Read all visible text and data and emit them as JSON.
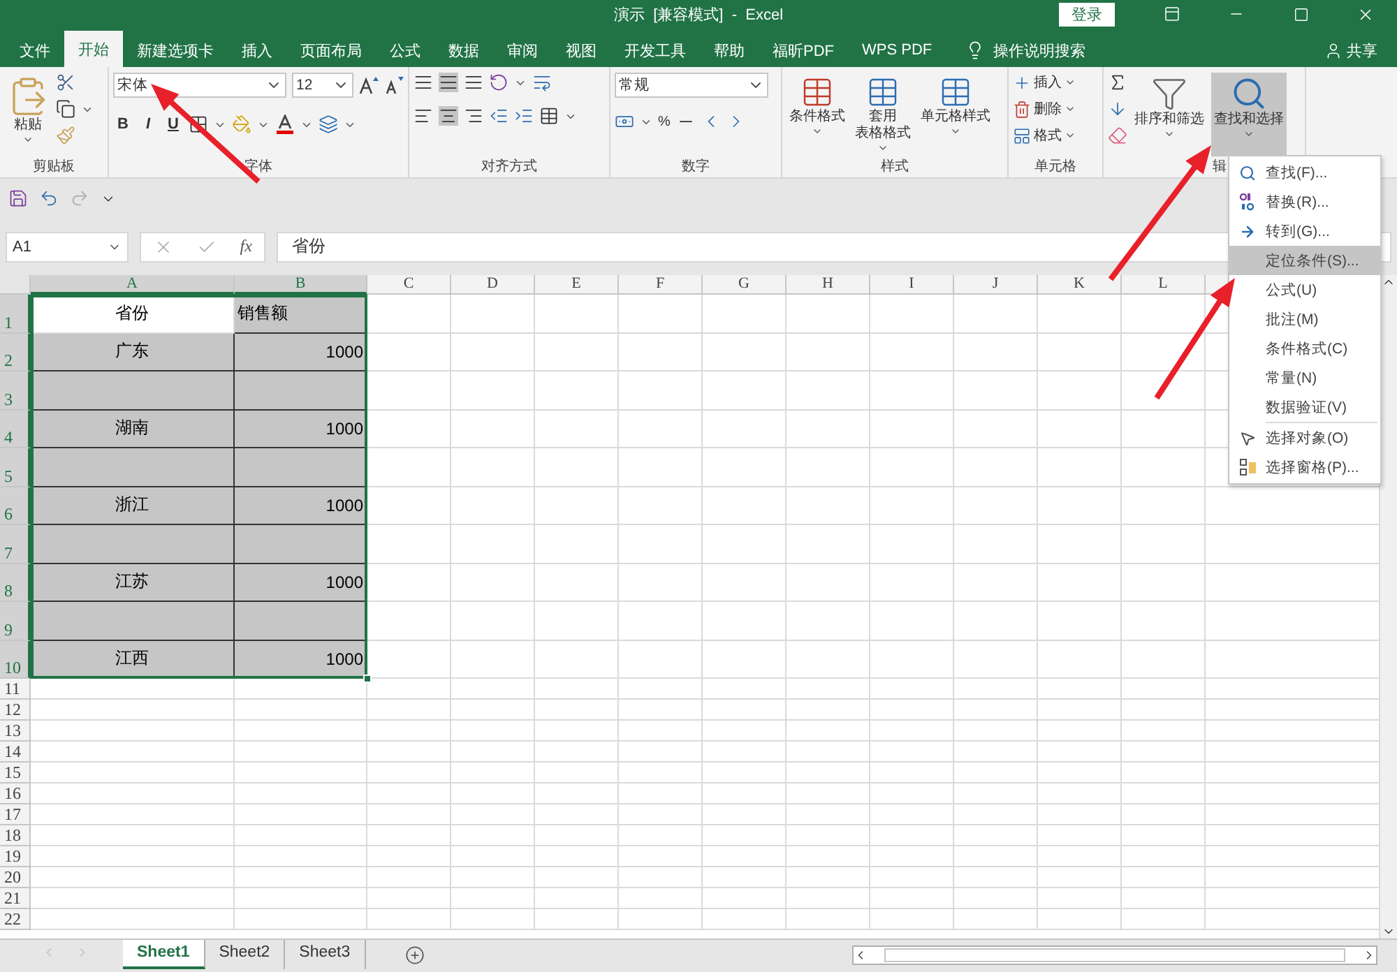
{
  "title_bar": {
    "title": "演示  [兼容模式]  -  Excel",
    "sign_in": "登录"
  },
  "tabs": [
    {
      "label": "文件",
      "selected": false
    },
    {
      "label": "开始",
      "selected": true
    },
    {
      "label": "新建选项卡",
      "selected": false
    },
    {
      "label": "插入",
      "selected": false
    },
    {
      "label": "页面布局",
      "selected": false
    },
    {
      "label": "公式",
      "selected": false
    },
    {
      "label": "数据",
      "selected": false
    },
    {
      "label": "审阅",
      "selected": false
    },
    {
      "label": "视图",
      "selected": false
    },
    {
      "label": "开发工具",
      "selected": false
    },
    {
      "label": "帮助",
      "selected": false
    },
    {
      "label": "福昕PDF",
      "selected": false
    },
    {
      "label": "WPS PDF",
      "selected": false
    }
  ],
  "tell_me": "操作说明搜索",
  "share": "共享",
  "ribbon": {
    "clipboard": {
      "label": "剪贴板",
      "paste": "粘贴"
    },
    "font": {
      "label": "字体",
      "font_name": "宋体",
      "font_size": "12",
      "bold": "B",
      "italic": "I",
      "underline": "U"
    },
    "alignment": {
      "label": "对齐方式"
    },
    "number": {
      "label": "数字",
      "format": "常规",
      "percent": "%"
    },
    "styles": {
      "label": "样式",
      "buttons": [
        {
          "lines": [
            "条件格式"
          ]
        },
        {
          "lines": [
            "套用",
            "表格格式"
          ]
        },
        {
          "lines": [
            "单元格样式"
          ]
        }
      ]
    },
    "cells": {
      "label": "单元格",
      "buttons": [
        "插入",
        "删除",
        "格式"
      ]
    },
    "editing": {
      "label": "辑",
      "sort": "排序和筛选",
      "find": "查找和选择",
      "find_selected": true
    }
  },
  "formula_bar": {
    "name_box": "A1",
    "fx": "fx",
    "value": "省份"
  },
  "columns": [
    {
      "label": "A",
      "selected": true
    },
    {
      "label": "B",
      "selected": true
    },
    {
      "label": "C",
      "selected": false
    },
    {
      "label": "D",
      "selected": false
    },
    {
      "label": "E",
      "selected": false
    },
    {
      "label": "F",
      "selected": false
    },
    {
      "label": "G",
      "selected": false
    },
    {
      "label": "H",
      "selected": false
    },
    {
      "label": "I",
      "selected": false
    },
    {
      "label": "J",
      "selected": false
    },
    {
      "label": "K",
      "selected": false
    },
    {
      "label": "L",
      "selected": false
    }
  ],
  "rows": [
    {
      "header": "1",
      "selected": true,
      "cells": [
        {
          "text": "省份",
          "selected": false
        },
        {
          "text": "销售额",
          "selected": true
        }
      ]
    },
    {
      "header": "2",
      "selected": true,
      "cells": [
        {
          "text": "广东",
          "selected": true
        },
        {
          "text": "1000",
          "selected": true
        }
      ]
    },
    {
      "header": "3",
      "selected": true,
      "cells": [
        {
          "selected": true
        },
        {
          "selected": true
        }
      ]
    },
    {
      "header": "4",
      "selected": true,
      "cells": [
        {
          "text": "湖南",
          "selected": true
        },
        {
          "text": "1000",
          "selected": true
        }
      ]
    },
    {
      "header": "5",
      "selected": true,
      "cells": [
        {
          "selected": true
        },
        {
          "selected": true
        }
      ]
    },
    {
      "header": "6",
      "selected": true,
      "cells": [
        {
          "text": "浙江",
          "selected": true
        },
        {
          "text": "1000",
          "selected": true
        }
      ]
    },
    {
      "header": "7",
      "selected": true,
      "cells": [
        {
          "selected": true
        },
        {
          "selected": true
        }
      ]
    },
    {
      "header": "8",
      "selected": true,
      "cells": [
        {
          "text": "江苏",
          "selected": true
        },
        {
          "text": "1000",
          "selected": true
        }
      ]
    },
    {
      "header": "9",
      "selected": true,
      "cells": [
        {
          "selected": true
        },
        {
          "selected": true
        }
      ]
    },
    {
      "header": "10",
      "selected": true,
      "cells": [
        {
          "text": "江西",
          "selected": true
        },
        {
          "text": "1000",
          "selected": true
        }
      ]
    },
    {
      "header": "11",
      "selected": false
    },
    {
      "header": "12",
      "selected": false
    },
    {
      "header": "13",
      "selected": false
    },
    {
      "header": "14",
      "selected": false
    },
    {
      "header": "15",
      "selected": false
    },
    {
      "header": "16",
      "selected": false
    },
    {
      "header": "17",
      "selected": false
    },
    {
      "header": "18",
      "selected": false
    },
    {
      "header": "19",
      "selected": false
    },
    {
      "header": "20",
      "selected": false
    },
    {
      "header": "21",
      "selected": false
    },
    {
      "header": "22",
      "selected": false
    }
  ],
  "sheets": [
    {
      "label": "Sheet1",
      "selected": true
    },
    {
      "label": "Sheet2",
      "selected": false
    },
    {
      "label": "Sheet3",
      "selected": false
    }
  ],
  "menu": {
    "groups": [
      [
        {
          "kind": "find",
          "label": "查找(F)...",
          "selected": false
        },
        {
          "kind": "replace",
          "label": "替换(R)...",
          "selected": false
        },
        {
          "kind": "goto",
          "label": "转到(G)...",
          "selected": false
        },
        {
          "kind": "plain",
          "label": "定位条件(S)...",
          "selected": true
        },
        {
          "kind": "plain",
          "label": "公式(U)",
          "selected": false
        },
        {
          "kind": "plain",
          "label": "批注(M)",
          "selected": false
        },
        {
          "kind": "plain",
          "label": "条件格式(C)",
          "selected": false
        },
        {
          "kind": "plain",
          "label": "常量(N)",
          "selected": false
        },
        {
          "kind": "plain",
          "label": "数据验证(V)",
          "selected": false
        }
      ],
      [
        {
          "kind": "pointer",
          "label": "选择对象(O)",
          "selected": false
        },
        {
          "kind": "pane",
          "label": "选择窗格(P)...",
          "selected": false
        }
      ]
    ]
  }
}
